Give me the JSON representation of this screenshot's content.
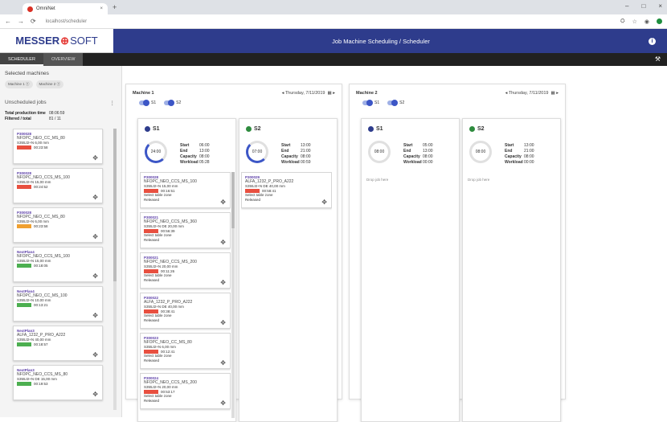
{
  "browser": {
    "tab_title": "OmniNet",
    "url": "localhost/scheduler"
  },
  "app": {
    "logo_left": "MESSER",
    "logo_right": "SOFT",
    "title": "Job Machine Scheduling / Scheduler"
  },
  "tabs": [
    {
      "label": "SCHEDULER"
    },
    {
      "label": "OVERVIEW"
    }
  ],
  "sidebar": {
    "selected_label": "Selected machines",
    "chips": [
      "Machine 1 ⓧ",
      "Machine 2 ⓧ"
    ],
    "unscheduled_label": "Unscheduled jobs",
    "total_label": "Total production time",
    "total_value": "08:06:59",
    "filtered_label": "Filtered / total",
    "filtered_value": "81 / 11",
    "cards": [
      {
        "id": "P300028",
        "name": "NFOPC_NEO_CC_MS_80",
        "l1": "S355J2+N   6,00 mm",
        "val": "00:23:58",
        "tag": "#e85040"
      },
      {
        "id": "P300028",
        "name": "NFOPC_NEO_CCS_MS_100",
        "l1": "S355J2+N   15,00 mm",
        "val": "00:24:52",
        "tag": "#e85040"
      },
      {
        "id": "P300028",
        "name": "NFOPC_NEO_CC_MS_80",
        "l1": "S355J2+N   6,00 mm",
        "val": "00:23:58",
        "tag": "#f0a030"
      },
      {
        "id": "NextPlan4",
        "name": "NFOPC_NEO_CCS_MS_100",
        "l1": "S355J2+N   15,00 mm",
        "val": "00:18:05",
        "tag": "#4caf50"
      },
      {
        "id": "NextPlan4",
        "name": "NFOPC_NEO_CC_MS_100",
        "l1": "S355J2+N   10,00 mm",
        "val": "00:13:21",
        "tag": "#4caf50"
      },
      {
        "id": "NextPlan3",
        "name": "ALFA_1232_P_PRO_A222",
        "l1": "S355J2+N   40,00 mm",
        "val": "00:18:57",
        "tag": "#4caf50"
      },
      {
        "id": "NextPlan3",
        "name": "NFOPC_NEO_CCS_MS_80",
        "l1": "S355J2+N DE   15,00 mm",
        "val": "00:19:53",
        "tag": "#4caf50"
      }
    ]
  },
  "machines": [
    {
      "name": "Machine 1",
      "date": "Thursday, 7/11/2019",
      "toggles": [
        "S1",
        "S2"
      ],
      "columns": [
        {
          "title": "S1",
          "color": "#2e3c8c",
          "gauge": "24:00",
          "start": "06:00",
          "end": "13:00",
          "capacity": "08:00",
          "workload": "05:28",
          "arc": "#3c56c6",
          "jobs": [
            {
              "id": "P300028",
              "name": "NFOPC_NEO_CCS_MS_100",
              "l1": "S355J2+N   15,00 mm",
              "val": "00:16:51",
              "l2": "Select table zone",
              "l3": "Released"
            },
            {
              "id": "P300021",
              "name": "NFOPC_NEO_CCS_MS_360",
              "l1": "S355J2+N DE   20,00 mm",
              "val": "00:56:39",
              "l2": "Select table zone",
              "l3": "Released"
            },
            {
              "id": "P300021",
              "name": "NFOPC_NEO_CCS_MS_200",
              "l1": "S355J2+N   20,00 mm",
              "val": "00:11:26",
              "l2": "Select table zone",
              "l3": "Released"
            },
            {
              "id": "P300022",
              "name": "ALFA_1232_P_PRO_A222",
              "l1": "S355J2+N DE   40,00 mm",
              "val": "00:38:41",
              "l2": "Select table zone",
              "l3": "Released"
            },
            {
              "id": "P300023",
              "name": "NFOPC_NEO_CC_MS_80",
              "l1": "S355J2+N   6,00 mm",
              "val": "00:12:41",
              "l2": "Select table zone",
              "l3": "Released"
            },
            {
              "id": "P300024",
              "name": "NFOPC_NEO_CCS_MS_200",
              "l1": "S355J2+N   20,00 mm",
              "val": "00:53:17",
              "l2": "Select table zone",
              "l3": "Released"
            }
          ]
        },
        {
          "title": "S2",
          "color": "#2e8b3e",
          "gauge": "07:00",
          "start": "13:00",
          "end": "21:00",
          "capacity": "08:00",
          "workload": "00:59",
          "arc": "#3c56c6",
          "jobs": [
            {
              "id": "P300029",
              "name": "ALFA_1232_P_PRO_A222",
              "l1": "S355J2+N DE   40,00 mm",
              "val": "00:58:41",
              "l2": "Select table zone",
              "l3": "Released"
            }
          ]
        }
      ]
    },
    {
      "name": "Machine 2",
      "date": "Thursday, 7/11/2019",
      "toggles": [
        "S1",
        "S2"
      ],
      "columns": [
        {
          "title": "S1",
          "color": "#2e3c8c",
          "gauge": "08:00",
          "start": "05:00",
          "end": "13:00",
          "capacity": "08:00",
          "workload": "00:00",
          "arc": "#e0e0e0",
          "drop": "Drop job here"
        },
        {
          "title": "S2",
          "color": "#2e8b3e",
          "gauge": "08:00",
          "start": "13:00",
          "end": "21:00",
          "capacity": "08:00",
          "workload": "00:00",
          "arc": "#e0e0e0",
          "drop": "Drop job here"
        }
      ]
    }
  ],
  "labels": {
    "start": "Start",
    "end": "End",
    "capacity": "Capacity",
    "workload": "Workload"
  }
}
